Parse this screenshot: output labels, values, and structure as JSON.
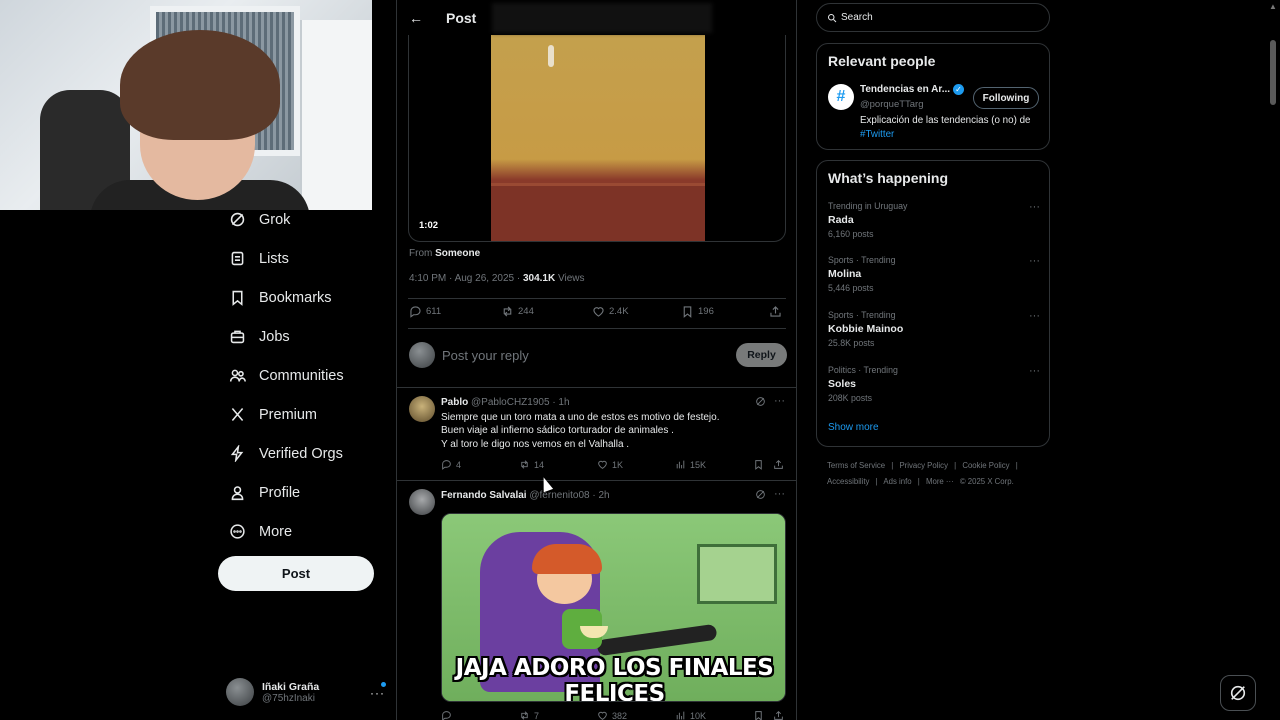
{
  "nav": {
    "items": [
      {
        "label": "Grok",
        "icon": "grok-icon"
      },
      {
        "label": "Lists",
        "icon": "lists-icon"
      },
      {
        "label": "Bookmarks",
        "icon": "bookmark-icon"
      },
      {
        "label": "Jobs",
        "icon": "briefcase-icon"
      },
      {
        "label": "Communities",
        "icon": "communities-icon"
      },
      {
        "label": "Premium",
        "icon": "x-logo-icon"
      },
      {
        "label": "Verified Orgs",
        "icon": "lightning-icon"
      },
      {
        "label": "Profile",
        "icon": "person-icon"
      },
      {
        "label": "More",
        "icon": "more-circle-icon"
      }
    ],
    "post_button": "Post",
    "account": {
      "name": "Iñaki Graña",
      "handle": "@75hzInaki"
    }
  },
  "header": {
    "title": "Post",
    "back": "←"
  },
  "main_post": {
    "duration": "1:02",
    "from_prefix": "From",
    "from_name": "Someone",
    "timestamp": "4:10 PM · Aug 26, 2025 ·",
    "views_count": "304.1K",
    "views_label": "Views",
    "replies": "611",
    "reposts": "244",
    "likes": "2.4K",
    "bookmarks": "196"
  },
  "reply_box": {
    "placeholder": "Post your reply",
    "button": "Reply"
  },
  "replies": [
    {
      "name": "Pablo",
      "handle": "@PabloCHZ1905",
      "time": "· 1h",
      "lines": [
        "Siempre que un toro mata a uno de estos es motivo de festejo.",
        "Buen viaje al infierno sádico torturador de animales .",
        "Y al toro le digo nos vemos en el Valhalla ."
      ],
      "replies": "4",
      "reposts": "14",
      "likes": "1K",
      "views": "15K"
    },
    {
      "name": "Fernando Salvalai",
      "handle": "@fernenito08",
      "time": "· 2h",
      "meme_caption": "JAJA ADORO LOS FINALES FELICES",
      "reposts": "7",
      "likes": "382",
      "views": "10K"
    }
  ],
  "search": {
    "placeholder": "Search"
  },
  "relevant_people": {
    "title": "Relevant people",
    "name": "Tendencias en Ar...",
    "handle": "@porqueTTarg",
    "bio": "Explicación de las tendencias (o no) de",
    "bio_tag": "#Twitter",
    "button": "Following"
  },
  "whats_happening": {
    "title": "What’s happening",
    "trends": [
      {
        "context": "Trending in Uruguay",
        "title": "Rada",
        "count": "6,160 posts"
      },
      {
        "context": "Sports · Trending",
        "title": "Molina",
        "count": "5,446 posts"
      },
      {
        "context": "Sports · Trending",
        "title": "Kobbie Mainoo",
        "count": "25.8K posts"
      },
      {
        "context": "Politics · Trending",
        "title": "Soles",
        "count": "208K posts"
      }
    ],
    "show_more": "Show more"
  },
  "footer": {
    "links": [
      "Terms of Service",
      "|",
      "Privacy Policy",
      "|",
      "Cookie Policy",
      "|"
    ],
    "links2": [
      "Accessibility",
      "|",
      "Ads info",
      "|",
      "More ···",
      "© 2025 X Corp."
    ]
  }
}
